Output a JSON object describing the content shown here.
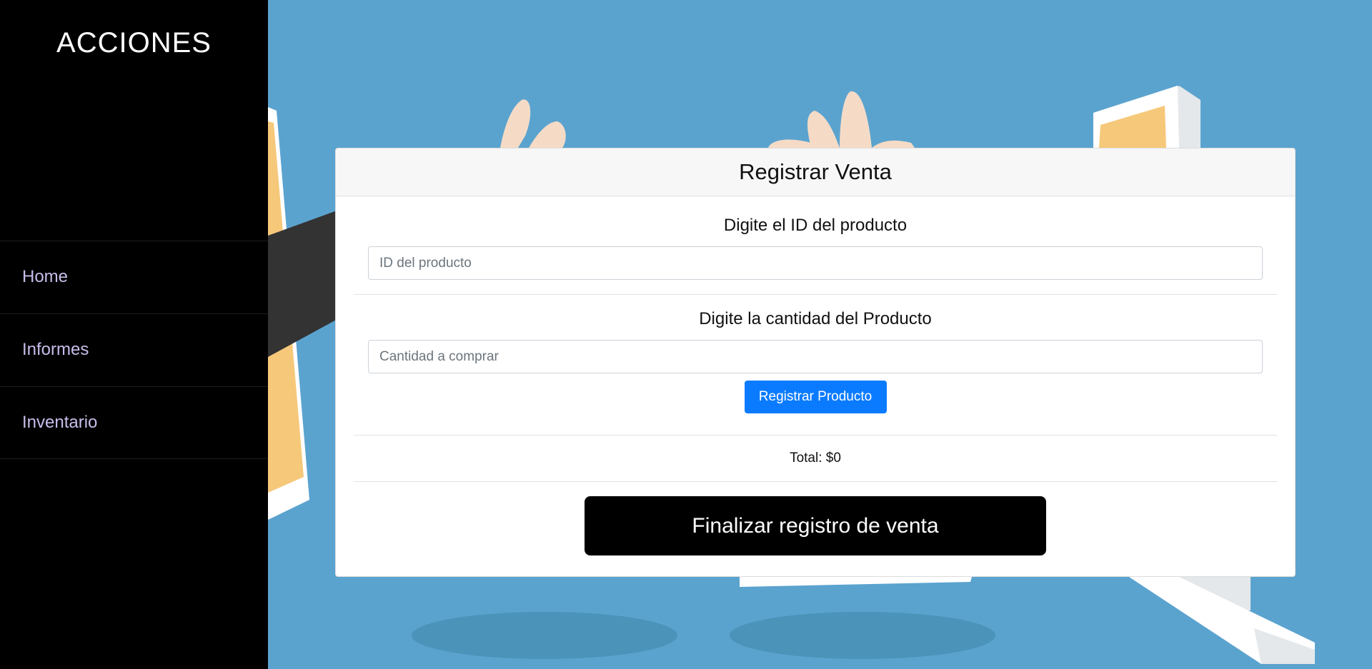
{
  "sidebar": {
    "title": "ACCIONES",
    "items": [
      {
        "label": "Home"
      },
      {
        "label": "Informes"
      },
      {
        "label": "Inventario"
      }
    ]
  },
  "card": {
    "title": "Registrar Venta",
    "product_id": {
      "label": "Digite el ID del producto",
      "placeholder": "ID del producto",
      "value": ""
    },
    "quantity": {
      "label": "Digite la cantidad del Producto",
      "placeholder": "Cantidad a comprar",
      "value": ""
    },
    "register_button": "Registrar Producto",
    "total_text": "Total: $0",
    "finish_button": "Finalizar registro de venta"
  },
  "colors": {
    "background": "#5ba3cf",
    "sidebar": "#000000",
    "primary_button": "#0a7bff",
    "finish_button": "#000000",
    "nav_text": "#c8bdea"
  }
}
